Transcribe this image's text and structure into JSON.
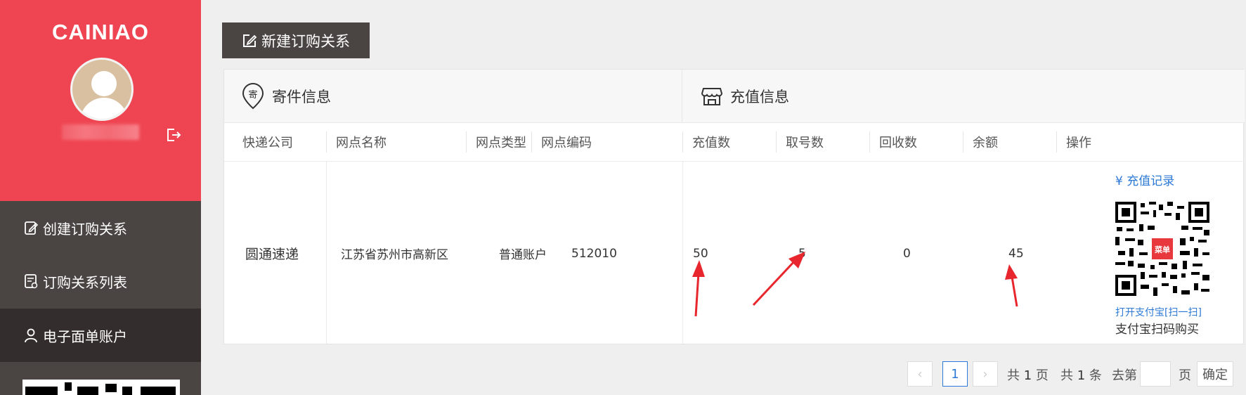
{
  "sidebar": {
    "logo": "CAINIAO",
    "items": [
      {
        "label": "创建订购关系",
        "icon": "edit-doc-icon"
      },
      {
        "label": "订购关系列表",
        "icon": "list-doc-icon"
      },
      {
        "label": "电子面单账户",
        "icon": "user-icon",
        "active": true
      }
    ]
  },
  "toolbar": {
    "new_label": "新建订购关系"
  },
  "groups": {
    "sender": "寄件信息",
    "recharge": "充值信息"
  },
  "sender_badge": "寄",
  "columns": [
    "快递公司",
    "网点名称",
    "网点类型",
    "网点编码",
    "充值数",
    "取号数",
    "回收数",
    "余额",
    "操作"
  ],
  "row": {
    "company": "圆通速递",
    "branch_name": "江苏省苏州市高新区",
    "branch_type": "普通账户",
    "branch_code": "512010",
    "recharge": "50",
    "taken": "5",
    "recycled": "0",
    "balance": "45",
    "op_link": "¥ 充值记录",
    "qr_badge": "菜单",
    "alipay_open": "打开支付宝[扫一扫]",
    "alipay_buy": "支付宝扫码购买"
  },
  "pagination": {
    "prev": "‹",
    "current": "1",
    "next": "›",
    "total_pages_prefix": "共",
    "total_pages": "1",
    "total_pages_suffix": "页",
    "total_items_prefix": "共",
    "total_items": "1",
    "total_items_suffix": "条",
    "goto_prefix": "去第",
    "goto_suffix": "页",
    "confirm": "确定"
  },
  "colors": {
    "brand_red": "#ef4552",
    "sidebar_dark": "#4a4443",
    "link_blue": "#2d79d6",
    "annotation_red": "#e8262d"
  }
}
